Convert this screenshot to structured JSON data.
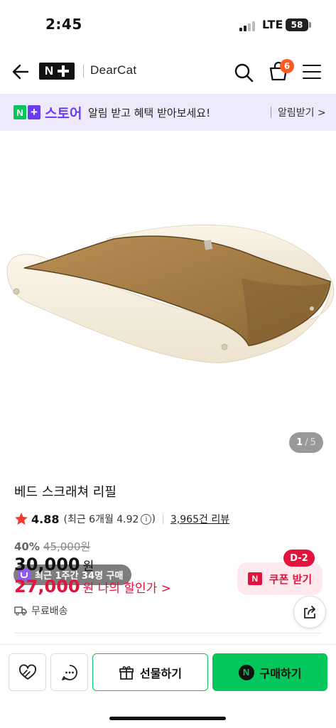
{
  "status_bar": {
    "time": "2:45",
    "network": "LTE",
    "battery": "58"
  },
  "header": {
    "logo_letter": "N",
    "brand": "DearCat",
    "cart_count": "6",
    "icons": [
      "back-arrow-icon",
      "search-icon",
      "cart-icon",
      "menu-icon"
    ]
  },
  "banner": {
    "logo_letter": "N",
    "store": "스토어",
    "text": "알림 받고 혜택 받아보세요!",
    "link": "알림받기 >",
    "accent_color": "#6a3df0",
    "background_color": "#eeeafc"
  },
  "gallery": {
    "social_proof": "최근 1주간 34명 구매",
    "current_page": "1",
    "page_separator": "/",
    "total_pages": "5"
  },
  "product": {
    "title": "베드 스크래쳐 리필",
    "rating": "4.88",
    "rating_recent": "(최근 6개월 4.92",
    "rating_recent_close": ")",
    "review_link": "3,965건 리뷰",
    "discount_rate": "40%",
    "original_price": "45,000원",
    "price": "30,000",
    "price_unit": "원",
    "my_price": "27,000",
    "my_price_label": "원 나의 할인가 >",
    "shipping": "무료배송"
  },
  "coupon": {
    "badge": "D-2",
    "logo_letter": "N",
    "label": "쿠폰 받기",
    "color": "#e0143c"
  },
  "bottom_bar": {
    "gift_label": "선물하기",
    "buy_logo": "N",
    "buy_label": "구매하기",
    "buy_color": "#03c75a"
  }
}
